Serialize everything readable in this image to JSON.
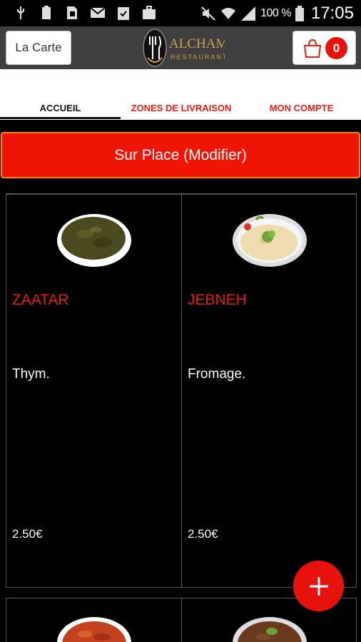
{
  "status_bar": {
    "left_icons": [
      "usb-icon",
      "battery-saver-icon",
      "sim-icon",
      "mail-icon",
      "clipboard-check-icon",
      "briefcase-icon"
    ],
    "right_icons": [
      "mute-icon",
      "wifi-icon",
      "signal-icon",
      "battery-icon"
    ],
    "battery_percent": "100 %",
    "time": "17:05"
  },
  "app_bar": {
    "menu_label": "La Carte",
    "logo_icon": "alchamy-logo",
    "cart_icon": "shopping-bag-icon",
    "cart_count": "0"
  },
  "nav": {
    "tabs": [
      {
        "label": "ACCUEIL",
        "active": true
      },
      {
        "label": "ZONES DE LIVRAISON",
        "active": false
      },
      {
        "label": "MON COMPTE",
        "active": false
      }
    ]
  },
  "mode_button": {
    "label": "Sur Place (Modifier)"
  },
  "products": [
    {
      "name": "ZAATAR",
      "description": "Thym.",
      "price": "2.50€",
      "image": "zaatar-flatbread-image"
    },
    {
      "name": "JEBNEH",
      "description": "Fromage.",
      "price": "2.50€",
      "image": "jebneh-flatbread-image"
    }
  ],
  "fab": {
    "icon": "plus-icon"
  },
  "colors": {
    "accent_red": "#e51f13",
    "button_red": "#ee1507",
    "appbar_gray": "#3f3f3f",
    "background": "#000000"
  }
}
